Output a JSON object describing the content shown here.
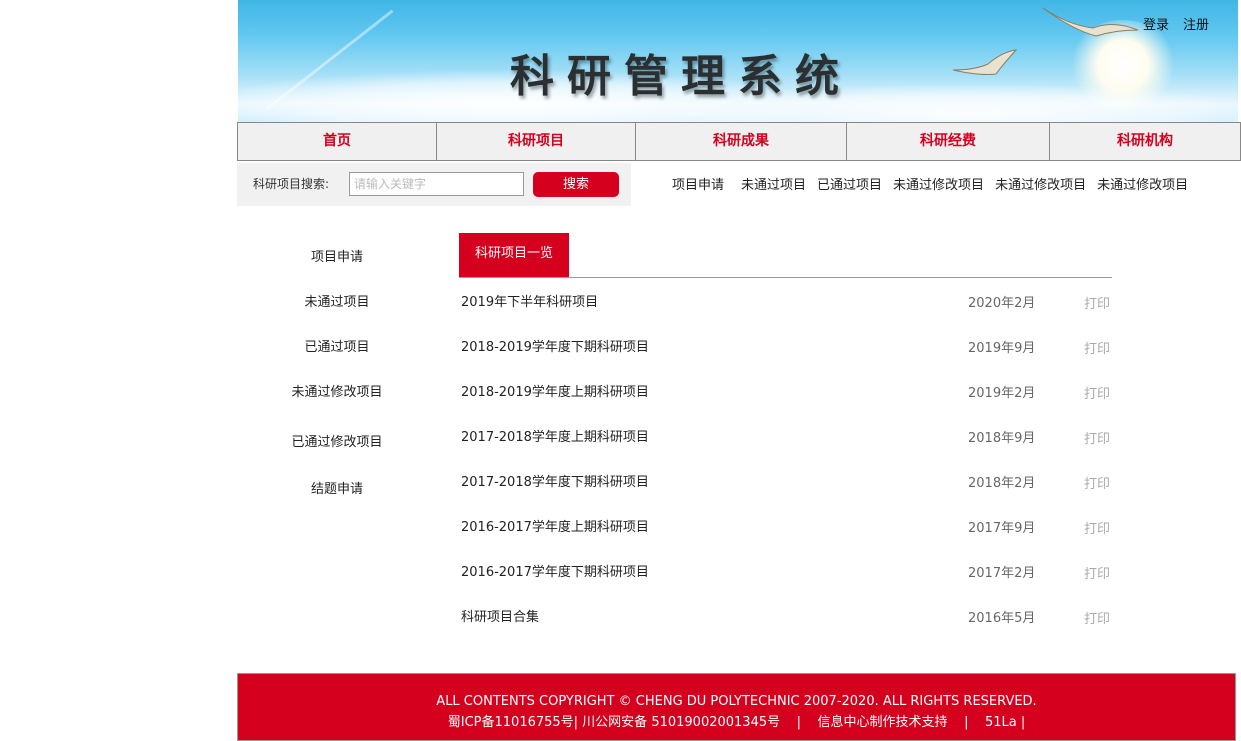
{
  "header": {
    "banner_title": "科研管理系统",
    "login": "登录",
    "register": "注册"
  },
  "nav": [
    {
      "label": "首页"
    },
    {
      "label": "科研项目"
    },
    {
      "label": "科研成果"
    },
    {
      "label": "科研经费"
    },
    {
      "label": "科研机构"
    }
  ],
  "search": {
    "label": "科研项目搜索:",
    "placeholder": "请输入关键字",
    "button": "搜索"
  },
  "quicklinks": [
    "项目申请",
    "未通过项目",
    "已通过项目",
    "未通过修改项目",
    "未通过修改项目",
    "未通过修改项目"
  ],
  "sidebar": [
    "项目申请",
    "未通过项目",
    "已通过项目",
    "未通过修改项目",
    "已通过修改项目",
    "结题申请"
  ],
  "main": {
    "tab": "科研项目一览",
    "print_label": "打印",
    "rows": [
      {
        "title": "2019年下半年科研项目",
        "date": "2020年2月"
      },
      {
        "title": "2018-2019学年度下期科研项目",
        "date": "2019年9月"
      },
      {
        "title": "2018-2019学年度上期科研项目",
        "date": "2019年2月"
      },
      {
        "title": "2017-2018学年度上期科研项目",
        "date": "2018年9月"
      },
      {
        "title": "2017-2018学年度下期科研项目",
        "date": "2018年2月"
      },
      {
        "title": "2016-2017学年度上期科研项目",
        "date": "2017年9月"
      },
      {
        "title": "2016-2017学年度下期科研项目",
        "date": "2017年2月"
      },
      {
        "title": "科研项目合集",
        "date": "2016年5月"
      }
    ]
  },
  "footer": {
    "line1": "ALL CONTENTS COPYRIGHT © CHENG DU POLYTECHNIC 2007-2020. ALL RIGHTS RESERVED.",
    "line2": "蜀ICP备11016755号| 川公网安备 51019002001345号    |    信息中心制作技术支持    |    51La |"
  },
  "colors": {
    "accent": "#d4001d",
    "nav_bg": "#f0f0f0",
    "search_bg": "#f1f1f1"
  }
}
